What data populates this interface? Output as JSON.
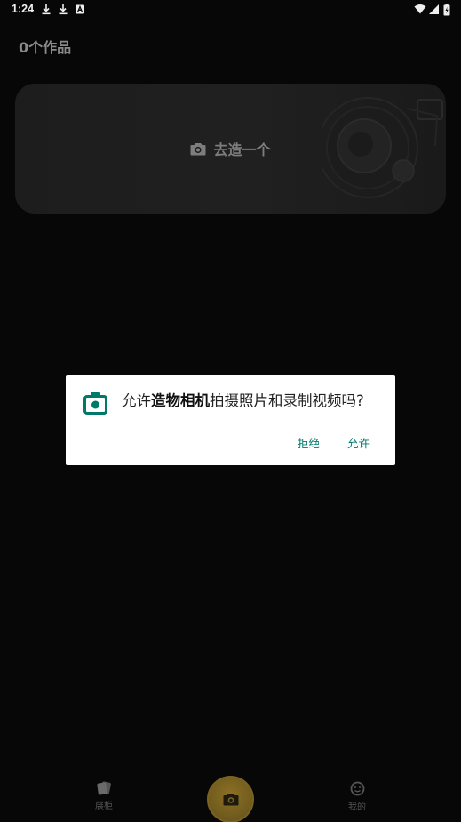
{
  "status_bar": {
    "time": "1:24",
    "left_icons": [
      "download-icon",
      "download-icon",
      "a-badge-icon"
    ],
    "right_icons": [
      "wifi-icon",
      "cell-signal-icon",
      "battery-icon"
    ]
  },
  "header": {
    "title": "0个作品"
  },
  "create_card": {
    "label": "去造一个",
    "icon": "camera-icon"
  },
  "permission_dialog": {
    "message_prefix": "允许",
    "app_name": "造物相机",
    "message_suffix": "拍摄照片和录制视频吗?",
    "deny_label": "拒绝",
    "allow_label": "允许",
    "icon": "camera-permission-icon",
    "accent_color": "#00796b"
  },
  "bottom_nav": {
    "items": [
      {
        "label": "展柜",
        "icon": "cards-icon"
      },
      {
        "label": "我的",
        "icon": "profile-icon"
      }
    ],
    "capture_icon": "camera-icon"
  },
  "colors": {
    "background": "#070707",
    "capture_button": "#7a6320"
  }
}
